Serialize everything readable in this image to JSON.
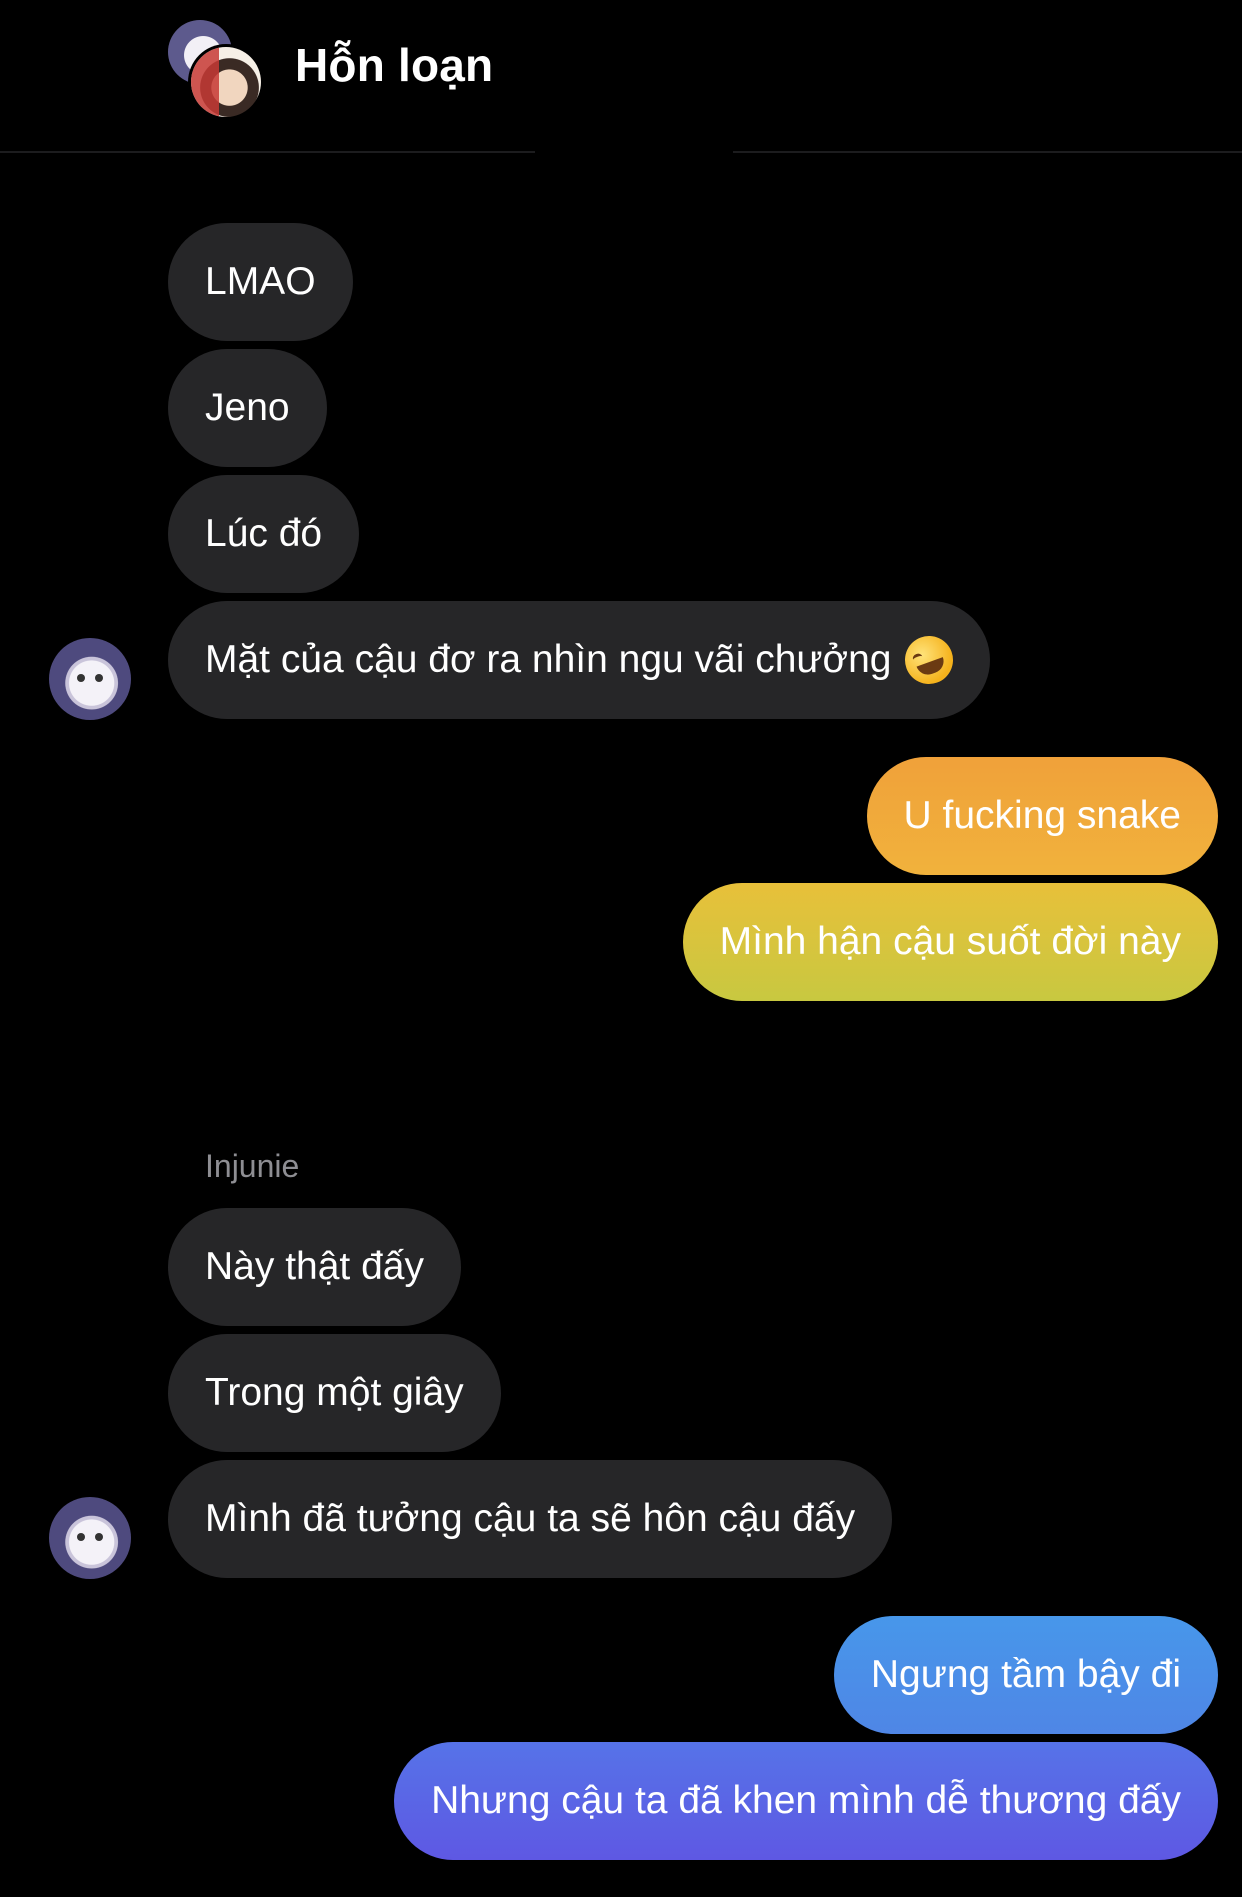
{
  "header": {
    "title": "Hỗn loạn"
  },
  "messages": {
    "m1": "LMAO",
    "m2": "Jeno",
    "m3": "Lúc đó",
    "m4": "Mặt của cậu đơ ra nhìn ngu vãi chưởng",
    "m4_emoji": "rolling-on-floor-laughing-emoji",
    "m5": "U fucking snake",
    "m6": "Mình hận cậu suốt đời này",
    "sender2": "Injunie",
    "m7": "Này thật đấy",
    "m8": "Trong một giây",
    "m9": "Mình đã tưởng cậu ta sẽ hôn cậu đấy",
    "m10": "Ngưng tầm bậy đi",
    "m11": "Nhưng cậu ta đã khen mình dễ thương đấy"
  },
  "colors": {
    "background": "#000000",
    "incoming_bubble": "#262628",
    "outgoing_orange": "#f0a23a",
    "outgoing_yellow": "#d9c23a",
    "outgoing_blue": "#4f8fe6",
    "outgoing_indigo": "#5a5ee6",
    "secondary_text": "#8e8e93"
  }
}
